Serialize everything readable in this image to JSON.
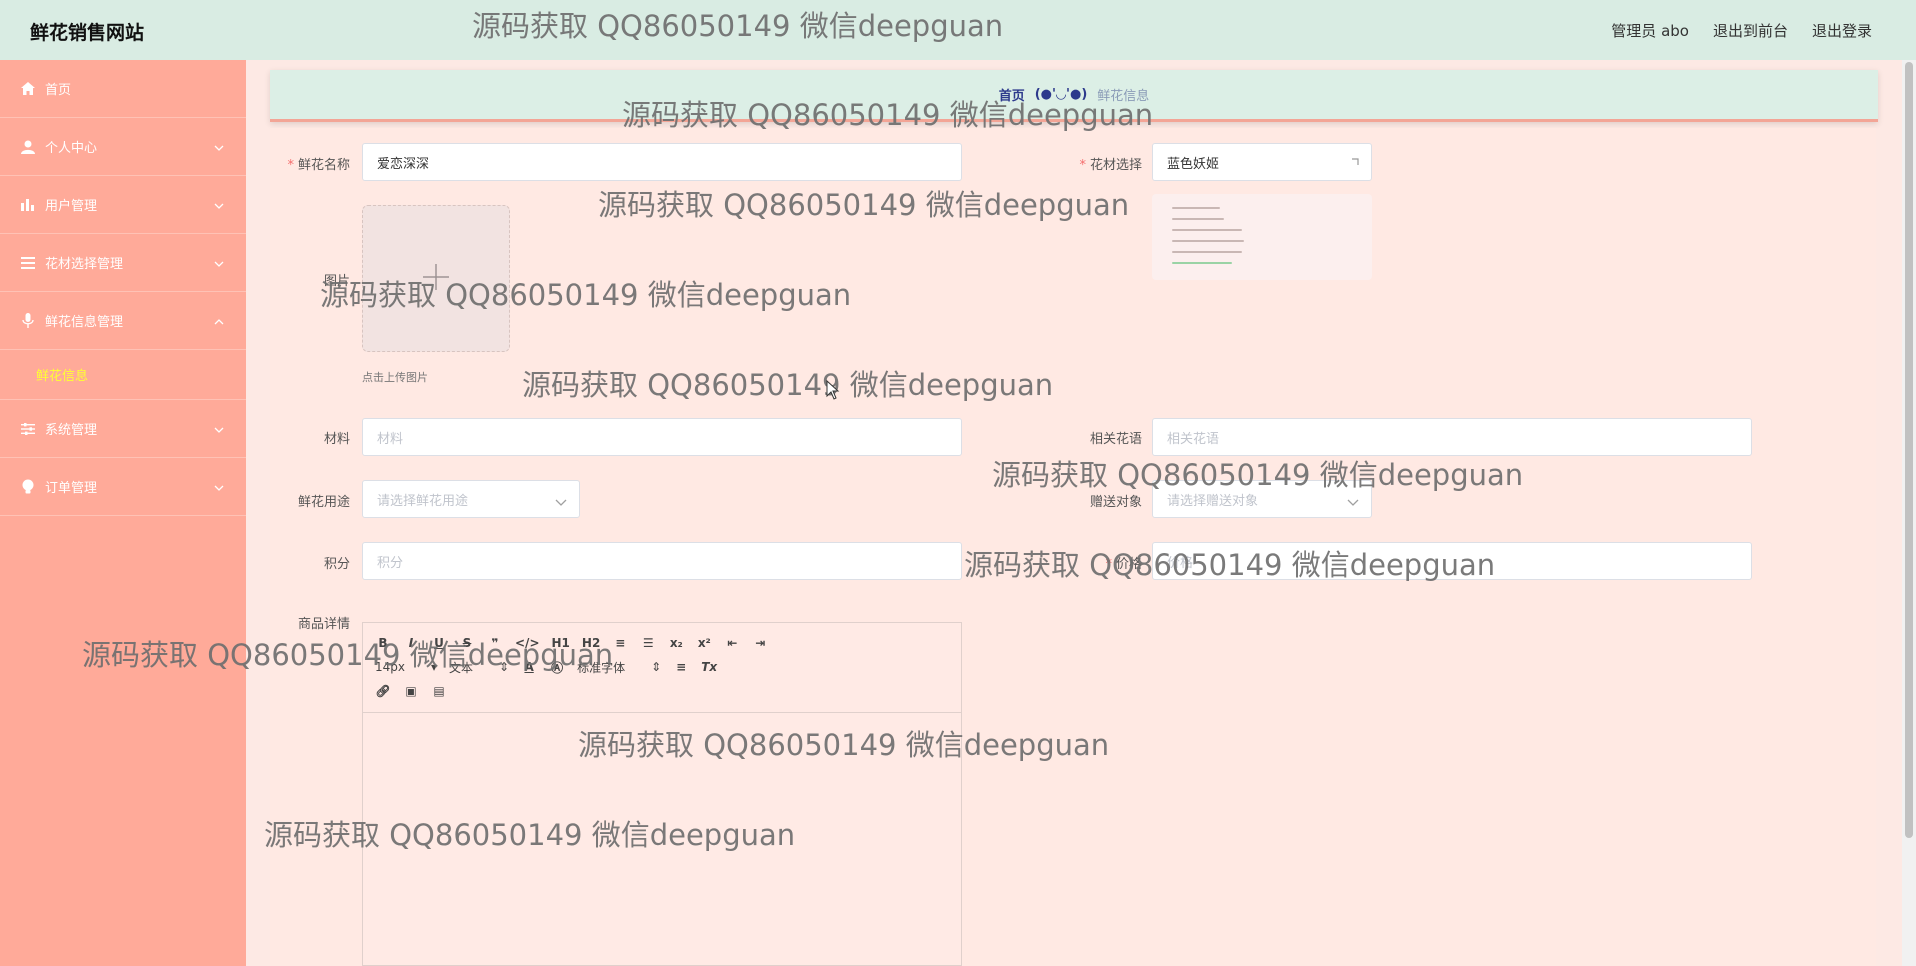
{
  "header": {
    "site_title": "鲜花销售网站",
    "user_label": "管理员 abo",
    "to_front_label": "退出到前台",
    "logout_label": "退出登录"
  },
  "sidebar": {
    "items": [
      {
        "label": "首页",
        "icon": "home-icon"
      },
      {
        "label": "个人中心",
        "icon": "user-icon"
      },
      {
        "label": "用户管理",
        "icon": "bar-chart-icon"
      },
      {
        "label": "花材选择管理",
        "icon": "list-icon"
      },
      {
        "label": "鲜花信息管理",
        "icon": "microphone-icon"
      },
      {
        "label": "系统管理",
        "icon": "sliders-icon"
      },
      {
        "label": "订单管理",
        "icon": "bulb-icon"
      }
    ],
    "sub_item": "鲜花信息"
  },
  "breadcrumb": {
    "home": "首页",
    "face": "(●'◡'●)",
    "current": "鲜花信息"
  },
  "form": {
    "name_label": "鲜花名称",
    "name_value": "爱恋深深",
    "material_select_label": "花材选择",
    "material_select_value": "蓝色妖姬",
    "image_label": "图片",
    "upload_tip": "点击上传图片",
    "material_label": "材料",
    "material_placeholder": "材料",
    "language_label": "相关花语",
    "language_placeholder": "相关花语",
    "purpose_label": "鲜花用途",
    "purpose_placeholder": "请选择鲜花用途",
    "recipient_label": "赠送对象",
    "recipient_placeholder": "请选择赠送对象",
    "points_label": "积分",
    "points_placeholder": "积分",
    "price_label": "价格",
    "price_placeholder": "价格",
    "detail_label": "商品详情"
  },
  "editor": {
    "row1": [
      "B",
      "I",
      "U",
      "S",
      "❞",
      "</>",
      "H1",
      "H2",
      "≡",
      "☰",
      "x₂",
      "x²",
      "⇤",
      "⇥"
    ],
    "font_size": "14px",
    "text_style": "文本",
    "font_family": "标准字体",
    "clear_format": "Tx"
  },
  "watermark": "源码获取 QQ86050149 微信deepguan",
  "colors": {
    "header_bg": "#d9ece3",
    "sidebar_bg": "#ffaa99",
    "form_bg": "#ffe9e3",
    "submenu_active": "#ffff33",
    "required": "#f56c6c"
  }
}
